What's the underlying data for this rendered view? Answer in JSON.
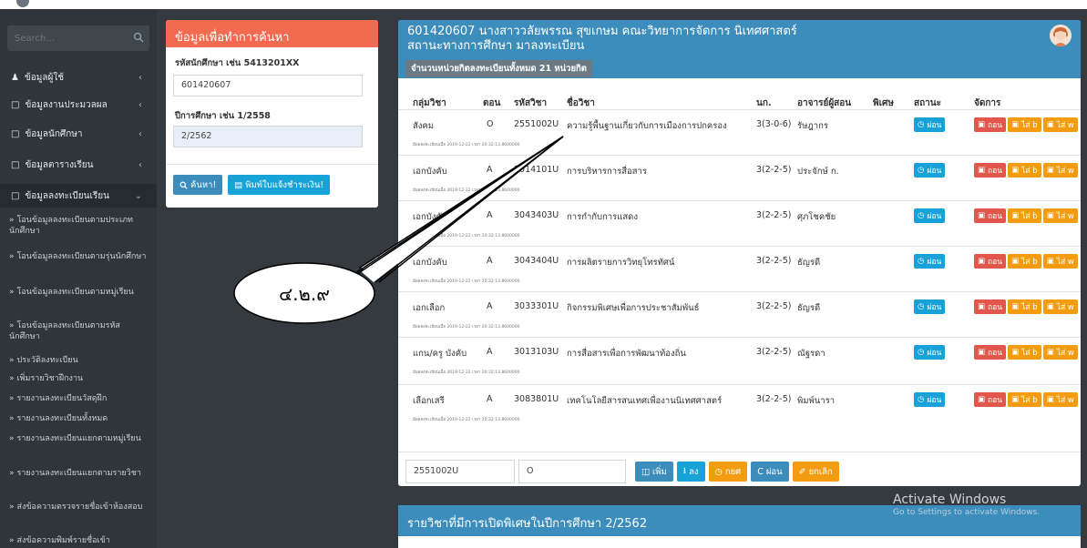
{
  "sidebar": {
    "search_placeholder": "Search...",
    "items": [
      {
        "label": "ข้อมูลผู้ใช้",
        "chev": "‹"
      },
      {
        "label": "ข้อมูลงานประมวลผล",
        "chev": "‹"
      },
      {
        "label": "ข้อมูลนักศึกษา",
        "chev": "‹"
      },
      {
        "label": "ข้อมูลตารางเรียน",
        "chev": "‹"
      },
      {
        "label": "ข้อมูลลงทะเบียนเรียน",
        "chev": "⌄"
      }
    ],
    "subitems": [
      "โอนข้อมูลลงทะเบียนตามประเภทนักศึกษา",
      "โอนข้อมูลลงทะเบียนตามรุ่นนักศึกษา",
      "โอนข้อมูลลงทะเบียนตามหมู่เรียน",
      "โอนข้อมูลลงทะเบียนตามรหัสนักศึกษา",
      "ประวัติลงทะเบียน",
      "เพิ่มรายวิชาฝึกงาน",
      "รายงานลงทะเบียนวัสดุฝึก",
      "รายงานลงทะเบียนทั้งหมด",
      "รายงานลงทะเบียนแยกตามหมู่เรียน",
      "รายงานลงทะเบียนแยกตามรายวิชา",
      "ส่งข้อความตรวจรายชื่อเข้าห้องสอบ",
      "ส่งข้อความพิมพ์รายชื่อเข้า"
    ],
    "sub_arrow": "»"
  },
  "search_panel": {
    "title": "ข้อมูลเพื่อทำการค้นหา",
    "student_label": "รหัสนักศึกษา เช่น 5413201XX",
    "student_value": "601420607",
    "year_label": "ปีการศึกษา เช่น 1/2558",
    "year_value": "2/2562",
    "search_button": "ค้นหา!",
    "print_button": "พิมพ์ใบแจ้งชำระเงิน!"
  },
  "main": {
    "title_line1": "601420607 นางสาววลัยพรรณ สุขเกษม คณะวิทยาการจัดการ นิเทศศาสตร์",
    "title_line2": "สถานะทางการศึกษา มาลงทะเบียน",
    "credits": "จำนวนหน่วยกิตลงทะเบียนทั้งหมด 21 หน่วยกิต",
    "columns": [
      "กลุ่มวิชา",
      "ตอน",
      "รหัสวิชา",
      "ชื่อวิชา",
      "นก.",
      "อาจารย์ผู้สอน",
      "พิเศษ",
      "สถานะ",
      "จัดการ"
    ],
    "rows": [
      {
        "group": "สังคม",
        "sec": "O",
        "code": "2551002U",
        "name": "ความรู้พื้นฐานเกี่ยวกับการเมืองการปกครอง",
        "credit": "3(3-0-6)",
        "teacher": "รัษฎากร",
        "updated": "มีผลลงทะเบียนเมื่อ 2019-12-22 เวลา 20:32:13.8600000"
      },
      {
        "group": "เอกบังคับ",
        "sec": "A",
        "code": "3014101U",
        "name": "การบริหารการสื่อสาร",
        "credit": "3(2-2-5)",
        "teacher": "ประจักษ์ ก.",
        "updated": "มีผลลงทะเบียนเมื่อ 2019-12-22 เวลา 20:32:13.8600000"
      },
      {
        "group": "เอกบังคับ",
        "sec": "A",
        "code": "3043403U",
        "name": "การกำกับการแสดง",
        "credit": "3(2-2-5)",
        "teacher": "ศุภโชคชัย",
        "updated": "มีผลลงทะเบียนเมื่อ 2019-12-22 เวลา 20:32:13.8600000"
      },
      {
        "group": "เอกบังคับ",
        "sec": "A",
        "code": "3043404U",
        "name": "การผลิตรายการวิทยุโทรทัศน์",
        "credit": "3(2-2-5)",
        "teacher": "ธัญรดี",
        "updated": "มีผลลงทะเบียนเมื่อ 2019-12-22 เวลา 20:32:13.8600000"
      },
      {
        "group": "เอกเลือก",
        "sec": "A",
        "code": "3033301U",
        "name": "กิจกรรมพิเศษเพื่อการประชาสัมพันธ์",
        "credit": "3(2-2-5)",
        "teacher": "ธัญรดี",
        "updated": "มีผลลงทะเบียนเมื่อ 2019-12-22 เวลา 20:32:13.8600000"
      },
      {
        "group": "แกน/ครู บังคับ",
        "sec": "A",
        "code": "3013103U",
        "name": "การสื่อสารเพื่อการพัฒนาท้องถิ่น",
        "credit": "3(2-2-5)",
        "teacher": "ณัฐรดา",
        "updated": "มีผลลงทะเบียนเมื่อ 2019-12-22 เวลา 20:32:13.8600000"
      },
      {
        "group": "เลือกเสรี",
        "sec": "A",
        "code": "3083801U",
        "name": "เทคโนโลยีสารสนเทศเพื่องานนิเทศศาสตร์",
        "credit": "3(2-2-5)",
        "teacher": "พิมพ์นารา",
        "updated": "มีผลลงทะเบียนเมื่อ 2019-12-22 เวลา 20:32:13.8600000"
      }
    ],
    "status_label": "ผ่อน",
    "action_labels": [
      "ถอน",
      "ไส่ b",
      "ไส่ w"
    ],
    "add_code": "2551002U",
    "add_sec": "O",
    "add_buttons": [
      "เพิ่ม",
      "ลง",
      "กยศ",
      "ผ่อน",
      "ยกเลิก"
    ]
  },
  "bottom_panel": {
    "title": "รายวิชาที่มีการเปิดพิเศษในปีการศึกษา 2/2562"
  },
  "watermark": {
    "line1": "Activate Windows",
    "line2": "Go to Settings to activate Windows."
  },
  "callout": {
    "label": "๔.๒.๙"
  }
}
